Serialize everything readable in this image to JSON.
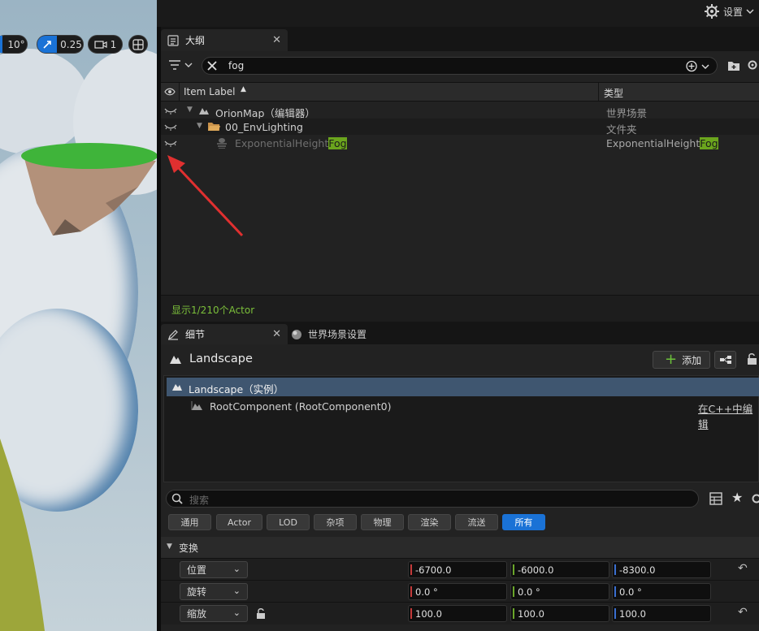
{
  "viewport": {
    "grid_snap": "10°",
    "scale_snap": "0.25",
    "camera_speed": "1"
  },
  "topbar": {
    "settings_label": "设置"
  },
  "outliner": {
    "tab_label": "大纲",
    "search_value": "fog",
    "columns": {
      "label": "Item Label",
      "type": "类型"
    },
    "rows": [
      {
        "label": "OrionMap（编辑器）",
        "type": "世界场景"
      },
      {
        "label": "00_EnvLighting",
        "type": "文件夹"
      },
      {
        "label_prefix": "ExponentialHeight",
        "label_match": "Fog",
        "type_prefix": "ExponentialHeight",
        "type_match": "Fog"
      }
    ],
    "status": "显示1/210个Actor"
  },
  "details": {
    "tab_label": "细节",
    "tab2_label": "世界场景设置",
    "actor_name": "Landscape",
    "add_label": "添加",
    "components": [
      {
        "label": "Landscape（实例）"
      },
      {
        "label": "RootComponent (RootComponent0)",
        "action": "在C++中编辑"
      }
    ],
    "search_placeholder": "搜索",
    "filters": [
      "通用",
      "Actor",
      "LOD",
      "杂项",
      "物理",
      "渲染",
      "流送",
      "所有"
    ],
    "section_title": "变换",
    "transform": [
      {
        "label": "位置",
        "x": "-6700.0",
        "y": "-6000.0",
        "z": "-8300.0"
      },
      {
        "label": "旋转",
        "x": "0.0 °",
        "y": "0.0 °",
        "z": "0.0 °"
      },
      {
        "label": "缩放",
        "x": "100.0",
        "y": "100.0",
        "z": "100.0"
      }
    ]
  },
  "colors": {
    "accent_blue": "#1a72d6",
    "match_green": "#6ba51d",
    "selected_row": "#3f5670",
    "status_green": "#7bbf3a",
    "arrow_red": "#e03030",
    "axis_x": "#c43a3a",
    "axis_y": "#6aa62a",
    "axis_z": "#3a6fd0"
  }
}
